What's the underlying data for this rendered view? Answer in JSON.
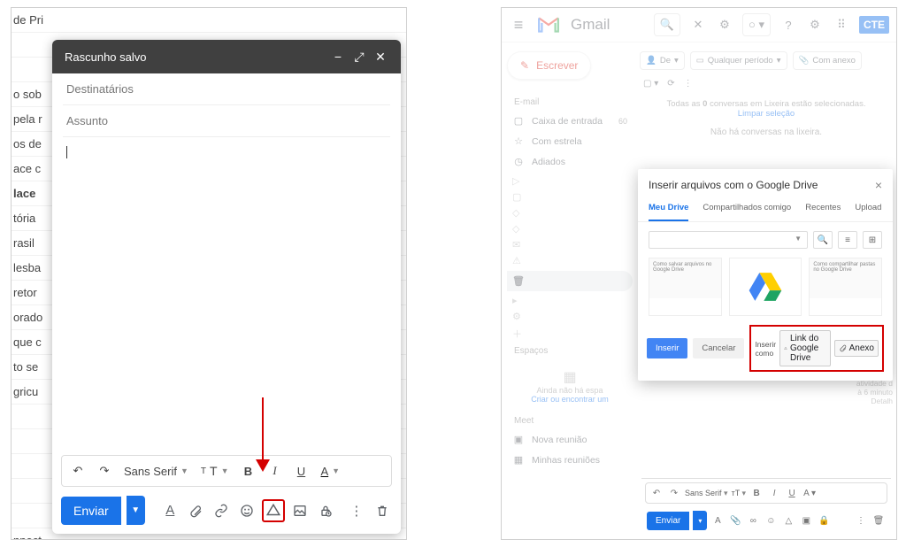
{
  "left": {
    "bg_items": [
      "de Pri",
      "o sob",
      "pela r",
      "os de",
      "ace c",
      "lace",
      "tória",
      "rasil",
      "lesba",
      "retor",
      "orado",
      "que c",
      "to se",
      "gricu",
      "nnect"
    ],
    "compose": {
      "title": "Rascunho salvo",
      "recipients_label": "Destinatários",
      "subject_label": "Assunto",
      "send_label": "Enviar",
      "font_label": "Sans Serif"
    }
  },
  "right": {
    "brand": "Gmail",
    "compose_btn": "Escrever",
    "filter_from": "De",
    "filter_date": "Qualquer período",
    "filter_attach": "Com anexo",
    "side_section_mail": "E-mail",
    "side_inbox": "Caixa de entrada",
    "side_inbox_count": "60",
    "side_star": "Com estrela",
    "side_snooze": "Adiados",
    "side_spaces": "Espaços",
    "spaces_t1": "Ainda não há espa",
    "spaces_t2": "Criar ou encontrar um",
    "side_meet": "Meet",
    "side_meet_new": "Nova reunião",
    "side_meet_my": "Minhas reuniões",
    "msg1a": "Todas as ",
    "msg1b": " conversas em Lixeira estão selecionadas.",
    "msg1c": "Limpar seleção",
    "msg1n": "0",
    "msg2": "Não há conversas na lixeira.",
    "footer1": "atividade d",
    "footer2": "à 6 minuto",
    "footer3": "Detalh",
    "picker": {
      "title": "Inserir arquivos com o Google Drive",
      "tab_mydrive": "Meu Drive",
      "tab_shared": "Compartilhados comigo",
      "tab_recent": "Recentes",
      "tab_upload": "Upload",
      "insert": "Inserir",
      "cancel": "Cancelar",
      "insert_as": "Inserir como",
      "drive_link": "Link do Google Drive",
      "attach": "Anexo",
      "card1_t": "Como salvar arquivos no Google Drive",
      "card3_t": "Como compartilhar pastas no Google Drive"
    },
    "mini": {
      "font": "Sans Serif",
      "send": "Enviar"
    }
  }
}
